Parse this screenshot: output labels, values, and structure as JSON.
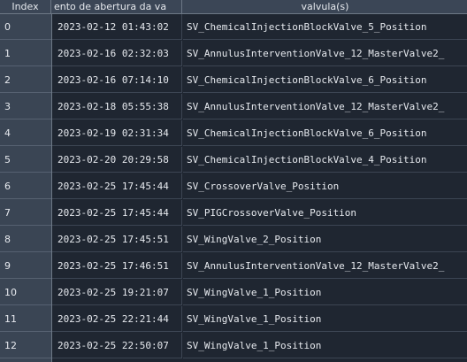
{
  "table": {
    "headers": {
      "index": "Index",
      "date": "ento de abertura da va",
      "valve": "valvula(s)"
    },
    "rows": [
      {
        "index": "0",
        "date": "2023-02-12 01:43:02",
        "valve": "SV_ChemicalInjectionBlockValve_5_Position"
      },
      {
        "index": "1",
        "date": "2023-02-16 02:32:03",
        "valve": "SV_AnnulusInterventionValve_12_MasterValve2_"
      },
      {
        "index": "2",
        "date": "2023-02-16 07:14:10",
        "valve": "SV_ChemicalInjectionBlockValve_6_Position"
      },
      {
        "index": "3",
        "date": "2023-02-18 05:55:38",
        "valve": "SV_AnnulusInterventionValve_12_MasterValve2_"
      },
      {
        "index": "4",
        "date": "2023-02-19 02:31:34",
        "valve": "SV_ChemicalInjectionBlockValve_6_Position"
      },
      {
        "index": "5",
        "date": "2023-02-20 20:29:58",
        "valve": "SV_ChemicalInjectionBlockValve_4_Position"
      },
      {
        "index": "6",
        "date": "2023-02-25 17:45:44",
        "valve": "SV_CrossoverValve_Position"
      },
      {
        "index": "7",
        "date": "2023-02-25 17:45:44",
        "valve": "SV_PIGCrossoverValve_Position"
      },
      {
        "index": "8",
        "date": "2023-02-25 17:45:51",
        "valve": "SV_WingValve_2_Position"
      },
      {
        "index": "9",
        "date": "2023-02-25 17:46:51",
        "valve": "SV_AnnulusInterventionValve_12_MasterValve2_"
      },
      {
        "index": "10",
        "date": "2023-02-25 19:21:07",
        "valve": "SV_WingValve_1_Position"
      },
      {
        "index": "11",
        "date": "2023-02-25 22:21:44",
        "valve": "SV_WingValve_1_Position"
      },
      {
        "index": "12",
        "date": "2023-02-25 22:50:07",
        "valve": "SV_WingValve_1_Position"
      }
    ]
  }
}
